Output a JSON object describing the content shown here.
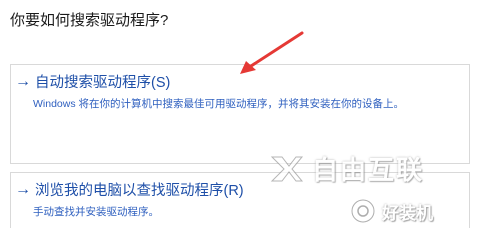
{
  "dialog": {
    "question": "你要如何搜索驱动程序?"
  },
  "options": {
    "auto_search": {
      "icon": "arrow-right-icon",
      "title": "自动搜索驱动程序(S)",
      "description": "Windows 将在你的计算机中搜索最佳可用驱动程序，并将其安装在你的设备上。"
    },
    "browse": {
      "icon": "arrow-right-icon",
      "title": "浏览我的电脑以查找驱动程序(R)",
      "description": "手动查找并安装驱动程序。"
    }
  },
  "watermarks": {
    "brand_text": "自由互联",
    "secondary_text": "好装机"
  },
  "colors": {
    "accent": "#1e4fa8",
    "annotation_arrow": "#e53935"
  }
}
